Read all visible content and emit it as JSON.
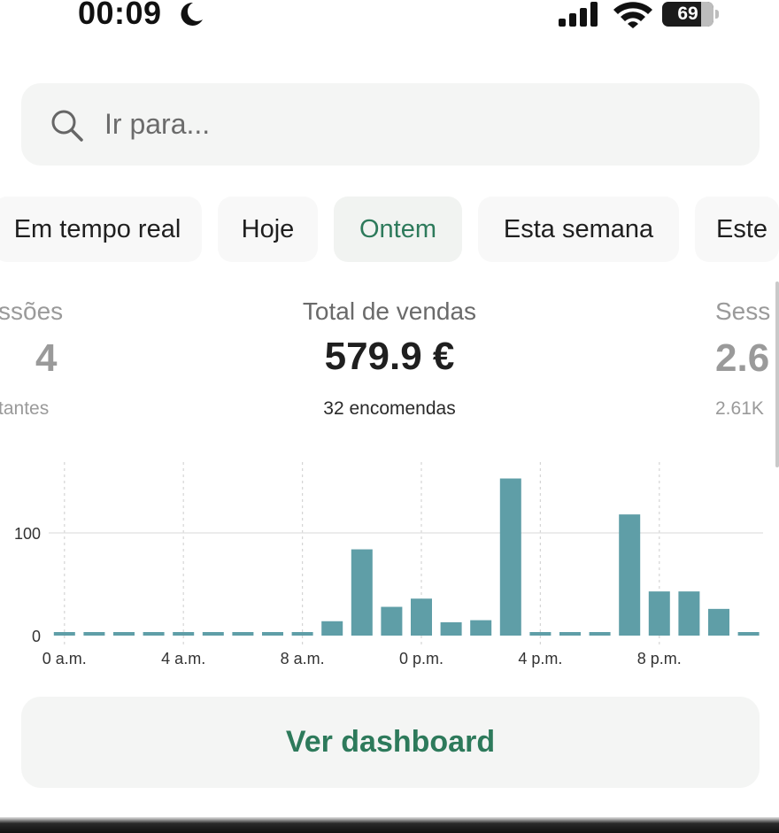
{
  "status_bar": {
    "time": "00:09",
    "battery": "69",
    "moon_icon": "moon-icon",
    "signal_icon": "cellular-signal-icon",
    "wifi_icon": "wifi-icon"
  },
  "search": {
    "placeholder": "Ir para...",
    "icon": "search-icon"
  },
  "tabs": [
    {
      "label": "Em tempo real",
      "active": false
    },
    {
      "label": "Hoje",
      "active": false
    },
    {
      "label": "Ontem",
      "active": true
    },
    {
      "label": "Esta semana",
      "active": false
    },
    {
      "label": "Este",
      "active": false
    }
  ],
  "metrics": {
    "left": {
      "label": "ssões",
      "value": "4",
      "sub": "tantes"
    },
    "center": {
      "label": "Total de vendas",
      "value": "579.9 €",
      "sub": "32 encomendas"
    },
    "right": {
      "label": "Sess",
      "value": "2.6",
      "sub": "2.61K"
    }
  },
  "colors": {
    "accent_green": "#2d7a5b",
    "bar_teal": "#5f9ea7",
    "muted_text": "#9a9a9a"
  },
  "chart_data": {
    "type": "bar",
    "categories": [
      "0",
      "1",
      "2",
      "3",
      "4",
      "5",
      "6",
      "7",
      "8",
      "9",
      "10",
      "11",
      "12",
      "13",
      "14",
      "15",
      "16",
      "17",
      "18",
      "19",
      "20",
      "21",
      "22",
      "23"
    ],
    "x_tick_labels": [
      "0 a.m.",
      "4 a.m.",
      "8 a.m.",
      "0 p.m.",
      "4 p.m.",
      "8 p.m."
    ],
    "x_tick_positions": [
      0,
      4,
      8,
      12,
      16,
      20
    ],
    "values": [
      2,
      2,
      2,
      2,
      2,
      2,
      2,
      2,
      2,
      14,
      84,
      28,
      36,
      13,
      15,
      153,
      2,
      2,
      2,
      118,
      43,
      43,
      26,
      2
    ],
    "y_ticks": [
      0,
      100
    ],
    "ylim": [
      0,
      170
    ],
    "grid": "y-dashed-at-x-ticks",
    "legend": "none",
    "title": "",
    "xlabel": "",
    "ylabel": ""
  },
  "dashboard_button": {
    "label": "Ver dashboard"
  }
}
